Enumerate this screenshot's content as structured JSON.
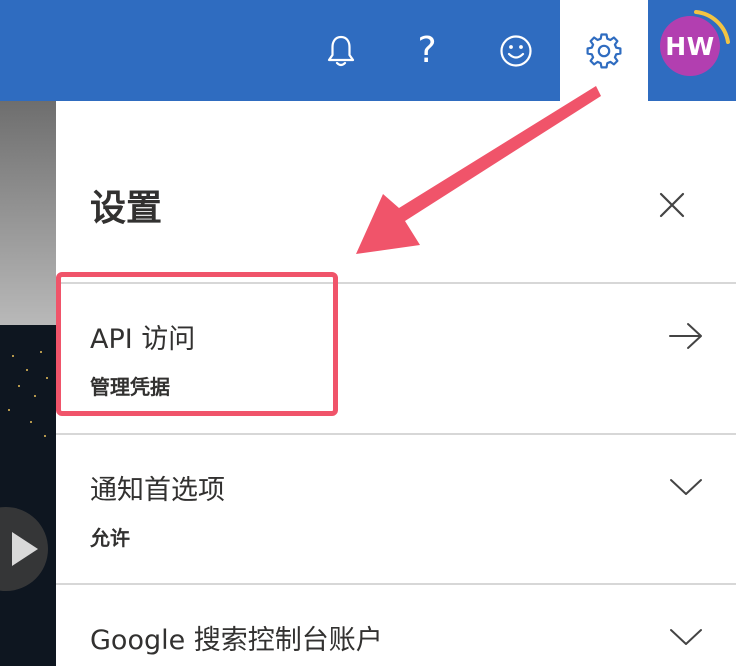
{
  "header": {
    "icons": [
      "bell-icon",
      "help-icon",
      "smiley-icon",
      "gear-icon"
    ],
    "avatar_initials": "HW",
    "avatar_color": "#b23fb0",
    "bar_color": "#2f6cc0",
    "help_glyph": "?"
  },
  "panel": {
    "title": "设置",
    "items": [
      {
        "title": "API 访问",
        "subtitle": "管理凭据",
        "icon": "arrow-right-icon"
      },
      {
        "title": "通知首选项",
        "subtitle": "允许",
        "icon": "chevron-down-icon"
      },
      {
        "title": "Google 搜索控制台账户",
        "subtitle": "",
        "icon": "chevron-down-icon"
      }
    ]
  },
  "annotation": {
    "color": "#f0546a"
  }
}
